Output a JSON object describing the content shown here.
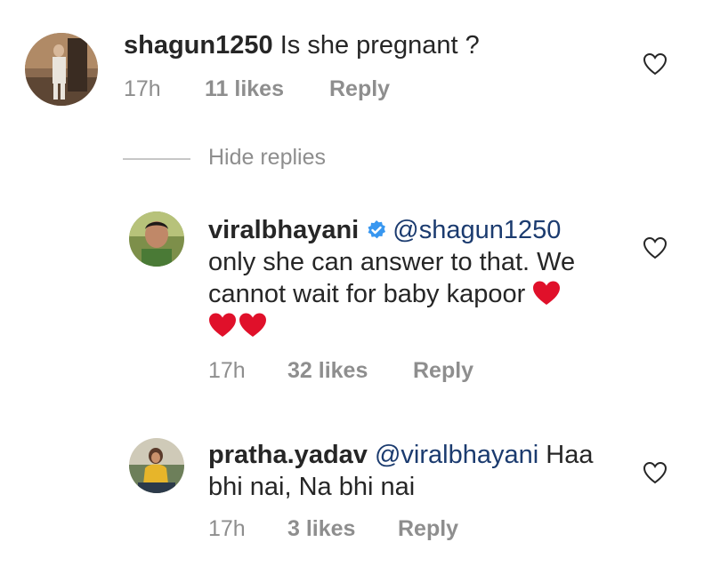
{
  "comments": [
    {
      "username": "shagun1250",
      "text": "Is she pregnant ?",
      "time": "17h",
      "likes": "11 likes",
      "reply": "Reply"
    }
  ],
  "hide_replies_label": "Hide replies",
  "replies": [
    {
      "username": "viralbhayani",
      "verified": true,
      "mention": "@shagun1250",
      "text_line1": "only she can answer to that. We",
      "text_line2": "cannot wait for baby kapoor",
      "time": "17h",
      "likes": "32 likes",
      "reply": "Reply"
    },
    {
      "username": "pratha.yadav",
      "mention": "@viralbhayani",
      "text_tail": "Haa",
      "text_line2": "bhi nai, Na bhi nai",
      "time": "17h",
      "likes": "3 likes",
      "reply": "Reply"
    }
  ],
  "colors": {
    "text": "#262626",
    "muted": "#8e8e8e",
    "mention": "#1b3b6f",
    "verified": "#3897f0",
    "heart_emoji": "#e0102a"
  },
  "icons": [
    "like-heart-icon",
    "verified-badge-icon",
    "red-heart-emoji"
  ]
}
